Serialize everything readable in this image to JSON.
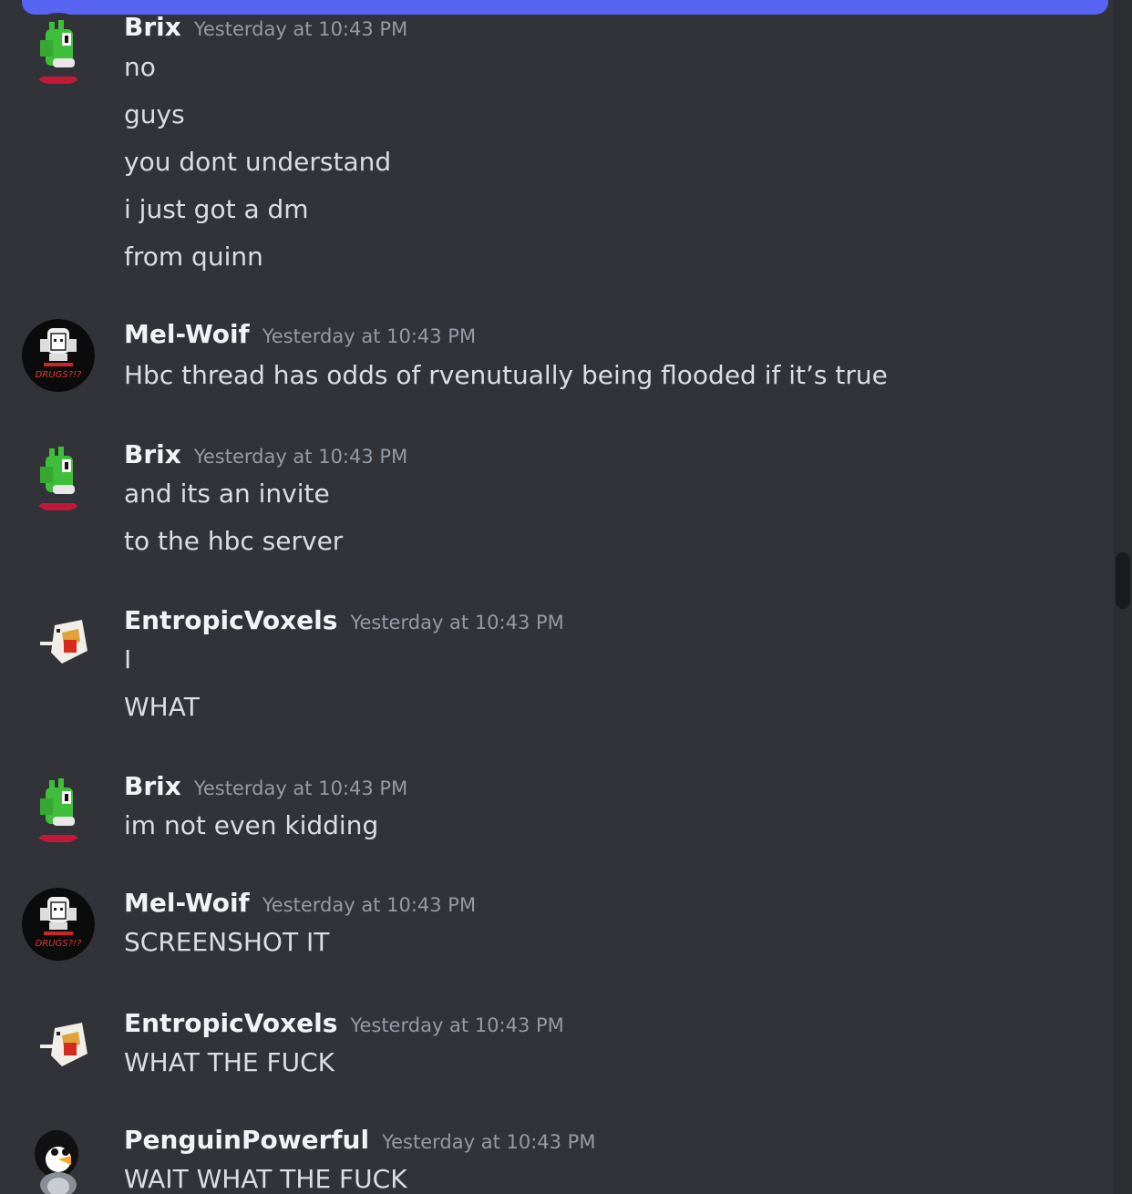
{
  "colors": {
    "background": "#313338",
    "accent_banner": "#5865f2",
    "username": "#f2f3f5",
    "timestamp": "#949ba4",
    "message_text": "#dbdee1"
  },
  "messages": [
    {
      "author": "Brix",
      "avatar_icon": "green-dragon-avatar-icon",
      "timestamp": "Yesterday at 10:43 PM",
      "lines": [
        "no",
        "guys",
        "you dont understand",
        "i just got a dm",
        "from quinn"
      ]
    },
    {
      "author": "Mel-Woif",
      "avatar_icon": "drugs-portrait-avatar-icon",
      "avatar_text": "DRUGS?!?",
      "timestamp": "Yesterday at 10:43 PM",
      "lines": [
        "Hbc thread has odds of rvenutually being flooded if it’s true"
      ]
    },
    {
      "author": "Brix",
      "avatar_icon": "green-dragon-avatar-icon",
      "timestamp": "Yesterday at 10:43 PM",
      "lines": [
        "and its an invite",
        "to the hbc server"
      ]
    },
    {
      "author": "EntropicVoxels",
      "avatar_icon": "voxel-chicken-avatar-icon",
      "timestamp": "Yesterday at 10:43 PM",
      "lines": [
        "I",
        "WHAT"
      ]
    },
    {
      "author": "Brix",
      "avatar_icon": "green-dragon-avatar-icon",
      "timestamp": "Yesterday at 10:43 PM",
      "lines": [
        "im not even kidding"
      ]
    },
    {
      "author": "Mel-Woif",
      "avatar_icon": "drugs-portrait-avatar-icon",
      "avatar_text": "DRUGS?!?",
      "timestamp": "Yesterday at 10:43 PM",
      "lines": [
        "SCREENSHOT IT"
      ]
    },
    {
      "author": "EntropicVoxels",
      "avatar_icon": "voxel-chicken-avatar-icon",
      "timestamp": "Yesterday at 10:43 PM",
      "lines": [
        "WHAT THE FUCK"
      ]
    },
    {
      "author": "PenguinPowerful",
      "avatar_icon": "penguin-avatar-icon",
      "timestamp": "Yesterday at 10:43 PM",
      "lines": [
        "WAIT WHAT THE FUCK"
      ]
    }
  ]
}
